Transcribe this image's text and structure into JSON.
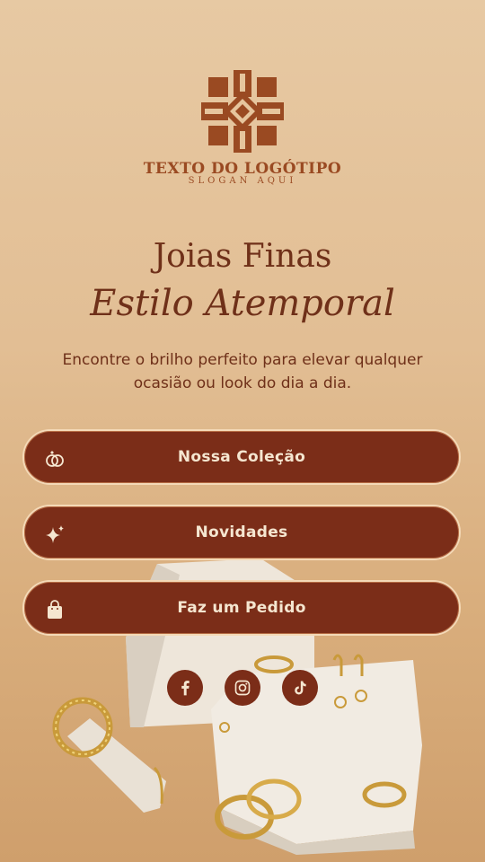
{
  "logo": {
    "name": "TEXTO DO LOGÓTIPO",
    "slogan": "SLOGAN AQUI"
  },
  "hero": {
    "title": "Joias Finas",
    "subtitle": "Estilo Atemporal",
    "description": "Encontre o brilho perfeito para elevar qualquer ocasião ou look do dia a dia."
  },
  "buttons": [
    {
      "label": "Nossa Coleção",
      "icon": "rings-icon"
    },
    {
      "label": "Novidades",
      "icon": "sparkle-icon"
    },
    {
      "label": "Faz um Pedido",
      "icon": "shopping-bag-icon"
    }
  ],
  "socials": [
    "facebook-icon",
    "instagram-icon",
    "tiktok-icon"
  ],
  "colors": {
    "primary": "#7b2d18",
    "text": "#6f3019",
    "logo": "#9a4a22",
    "background": "#e2be94",
    "button_text": "#f5e6d0"
  }
}
